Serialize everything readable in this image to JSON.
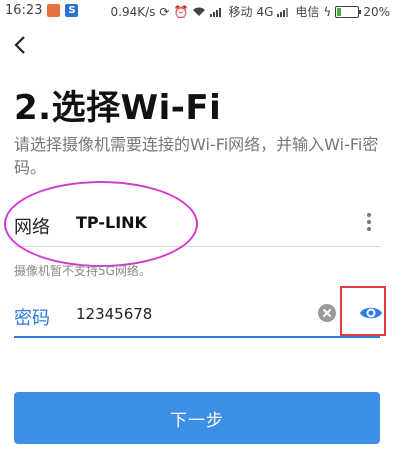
{
  "status_bar": {
    "time": "16:23",
    "speed": "0.94K/s",
    "carrier1": "移动",
    "network_type": "4G",
    "carrier2": "电信",
    "battery_percent": "20%",
    "battery_level": 0.2
  },
  "page": {
    "title": "2.选择Wi-Fi",
    "subtitle": "请选择摄像机需要连接的Wi-Fi网络，并输入Wi-Fi密码。"
  },
  "network": {
    "label": "网络",
    "value": "TP-LINK"
  },
  "hint": "摄像机暂不支持5G网络。",
  "password": {
    "label": "密码",
    "value": "12345678"
  },
  "next_button": "下一步",
  "colors": {
    "accent": "#2a7de1",
    "button": "#3b8fe6",
    "ellipse_annotation": "#d23ad6",
    "box_annotation": "#e23c3c"
  },
  "icons": [
    "back-arrow-icon",
    "more-vertical-icon",
    "clear-icon",
    "eye-icon"
  ]
}
